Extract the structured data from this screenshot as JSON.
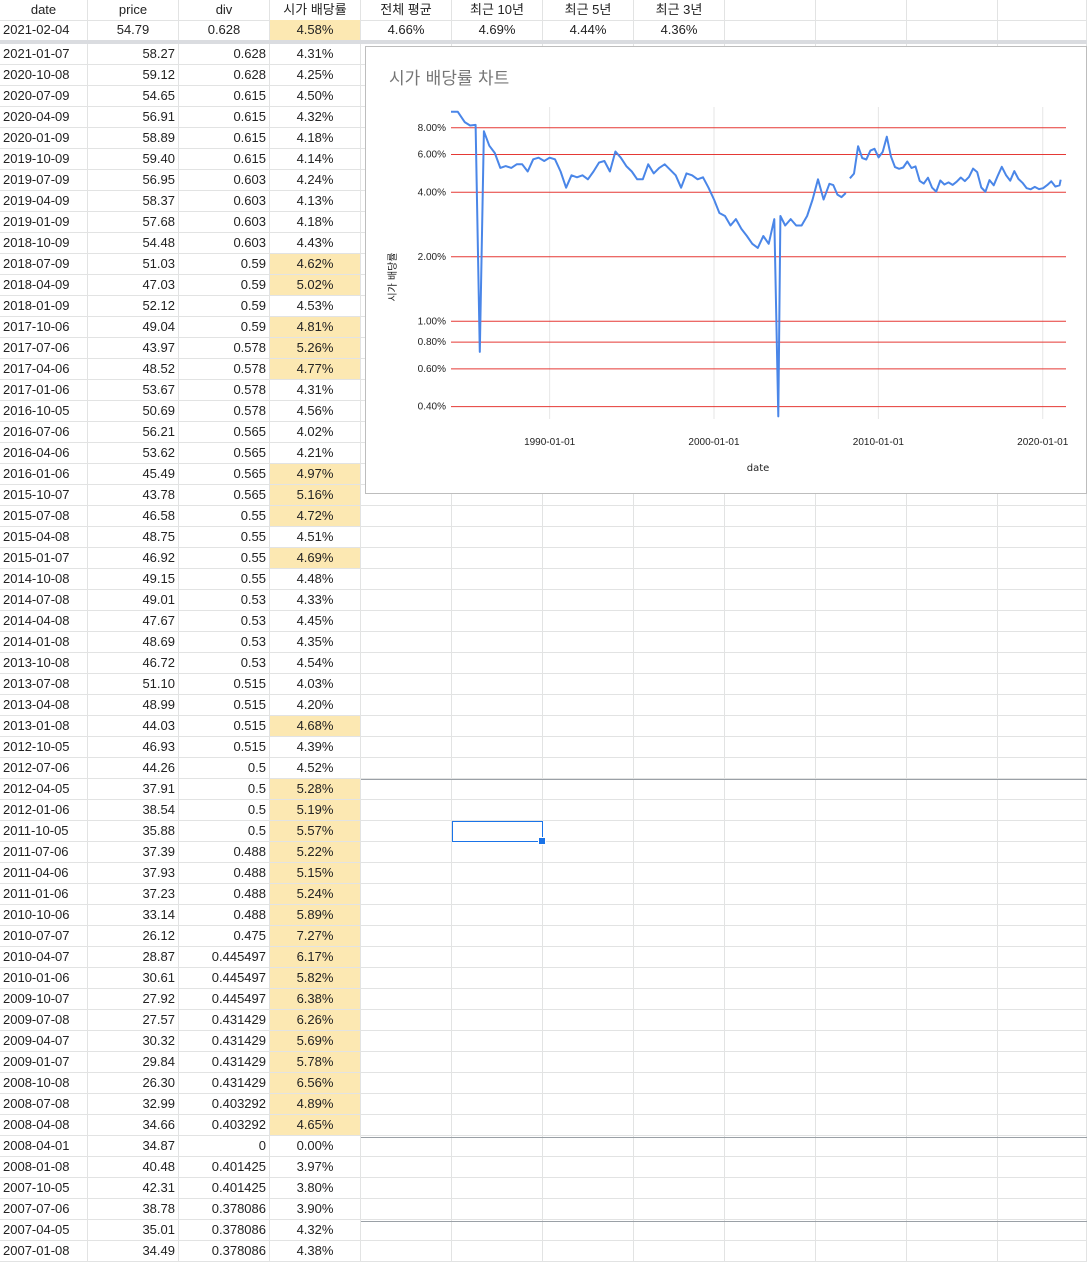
{
  "sheet": {
    "headers": [
      "date",
      "price",
      "div",
      "시가 배당률",
      "전체 평균",
      "최근 10년",
      "최근 5년",
      "최근 3년"
    ],
    "summary": [
      "2021-02-04",
      "54.79",
      "0.628",
      "4.58%",
      "4.66%",
      "4.69%",
      "4.44%",
      "4.36%"
    ],
    "rows": [
      [
        "2021-01-07",
        "58.27",
        "0.628",
        "4.31%"
      ],
      [
        "2020-10-08",
        "59.12",
        "0.628",
        "4.25%"
      ],
      [
        "2020-07-09",
        "54.65",
        "0.615",
        "4.50%"
      ],
      [
        "2020-04-09",
        "56.91",
        "0.615",
        "4.32%"
      ],
      [
        "2020-01-09",
        "58.89",
        "0.615",
        "4.18%"
      ],
      [
        "2019-10-09",
        "59.40",
        "0.615",
        "4.14%"
      ],
      [
        "2019-07-09",
        "56.95",
        "0.603",
        "4.24%"
      ],
      [
        "2019-04-09",
        "58.37",
        "0.603",
        "4.13%"
      ],
      [
        "2019-01-09",
        "57.68",
        "0.603",
        "4.18%"
      ],
      [
        "2018-10-09",
        "54.48",
        "0.603",
        "4.43%"
      ],
      [
        "2018-07-09",
        "51.03",
        "0.59",
        "4.62%"
      ],
      [
        "2018-04-09",
        "47.03",
        "0.59",
        "5.02%"
      ],
      [
        "2018-01-09",
        "52.12",
        "0.59",
        "4.53%"
      ],
      [
        "2017-10-06",
        "49.04",
        "0.59",
        "4.81%"
      ],
      [
        "2017-07-06",
        "43.97",
        "0.578",
        "5.26%"
      ],
      [
        "2017-04-06",
        "48.52",
        "0.578",
        "4.77%"
      ],
      [
        "2017-01-06",
        "53.67",
        "0.578",
        "4.31%"
      ],
      [
        "2016-10-05",
        "50.69",
        "0.578",
        "4.56%"
      ],
      [
        "2016-07-06",
        "56.21",
        "0.565",
        "4.02%"
      ],
      [
        "2016-04-06",
        "53.62",
        "0.565",
        "4.21%"
      ],
      [
        "2016-01-06",
        "45.49",
        "0.565",
        "4.97%"
      ],
      [
        "2015-10-07",
        "43.78",
        "0.565",
        "5.16%"
      ],
      [
        "2015-07-08",
        "46.58",
        "0.55",
        "4.72%"
      ],
      [
        "2015-04-08",
        "48.75",
        "0.55",
        "4.51%"
      ],
      [
        "2015-01-07",
        "46.92",
        "0.55",
        "4.69%"
      ],
      [
        "2014-10-08",
        "49.15",
        "0.55",
        "4.48%"
      ],
      [
        "2014-07-08",
        "49.01",
        "0.53",
        "4.33%"
      ],
      [
        "2014-04-08",
        "47.67",
        "0.53",
        "4.45%"
      ],
      [
        "2014-01-08",
        "48.69",
        "0.53",
        "4.35%"
      ],
      [
        "2013-10-08",
        "46.72",
        "0.53",
        "4.54%"
      ],
      [
        "2013-07-08",
        "51.10",
        "0.515",
        "4.03%"
      ],
      [
        "2013-04-08",
        "48.99",
        "0.515",
        "4.20%"
      ],
      [
        "2013-01-08",
        "44.03",
        "0.515",
        "4.68%"
      ],
      [
        "2012-10-05",
        "46.93",
        "0.515",
        "4.39%"
      ],
      [
        "2012-07-06",
        "44.26",
        "0.5",
        "4.52%"
      ],
      [
        "2012-04-05",
        "37.91",
        "0.5",
        "5.28%"
      ],
      [
        "2012-01-06",
        "38.54",
        "0.5",
        "5.19%"
      ],
      [
        "2011-10-05",
        "35.88",
        "0.5",
        "5.57%"
      ],
      [
        "2011-07-06",
        "37.39",
        "0.488",
        "5.22%"
      ],
      [
        "2011-04-06",
        "37.93",
        "0.488",
        "5.15%"
      ],
      [
        "2011-01-06",
        "37.23",
        "0.488",
        "5.24%"
      ],
      [
        "2010-10-06",
        "33.14",
        "0.488",
        "5.89%"
      ],
      [
        "2010-07-07",
        "26.12",
        "0.475",
        "7.27%"
      ],
      [
        "2010-04-07",
        "28.87",
        "0.445497",
        "6.17%"
      ],
      [
        "2010-01-06",
        "30.61",
        "0.445497",
        "5.82%"
      ],
      [
        "2009-10-07",
        "27.92",
        "0.445497",
        "6.38%"
      ],
      [
        "2009-07-08",
        "27.57",
        "0.431429",
        "6.26%"
      ],
      [
        "2009-04-07",
        "30.32",
        "0.431429",
        "5.69%"
      ],
      [
        "2009-01-07",
        "29.84",
        "0.431429",
        "5.78%"
      ],
      [
        "2008-10-08",
        "26.30",
        "0.431429",
        "6.56%"
      ],
      [
        "2008-07-08",
        "32.99",
        "0.403292",
        "4.89%"
      ],
      [
        "2008-04-08",
        "34.66",
        "0.403292",
        "4.65%"
      ],
      [
        "2008-04-01",
        "34.87",
        "0",
        "0.00%"
      ],
      [
        "2008-01-08",
        "40.48",
        "0.401425",
        "3.97%"
      ],
      [
        "2007-10-05",
        "42.31",
        "0.401425",
        "3.80%"
      ],
      [
        "2007-07-06",
        "38.78",
        "0.378086",
        "3.90%"
      ],
      [
        "2007-04-05",
        "35.01",
        "0.378086",
        "4.32%"
      ],
      [
        "2007-01-08",
        "34.49",
        "0.378086",
        "4.38%"
      ]
    ],
    "highlight_color": "#fce8b2",
    "highlight_threshold_pct": 4.58
  },
  "chart_data": {
    "type": "line",
    "title": "시가 배당률 차트",
    "xlabel": "date",
    "ylabel": "시가 배당률",
    "y_scale": "log",
    "ylim": [
      0.0035,
      0.1
    ],
    "xlim": [
      "1984-01-01",
      "2021-06-01"
    ],
    "x_ticks": [
      "1990-01-01",
      "2000-01-01",
      "2010-01-01",
      "2020-01-01"
    ],
    "y_ticks": [
      "0.40%",
      "0.60%",
      "0.80%",
      "1.00%",
      "2.00%",
      "4.00%",
      "6.00%",
      "8.00%"
    ],
    "y_tick_values": [
      0.004,
      0.006,
      0.008,
      0.01,
      0.02,
      0.04,
      0.06,
      0.08
    ],
    "grid_color": "#e53935",
    "line_color": "#4a86e8",
    "series": [
      {
        "values": [
          [
            "1984-01-01",
            0.095
          ],
          [
            "1984-06-01",
            0.095
          ],
          [
            "1984-11-01",
            0.085
          ],
          [
            "1985-03-01",
            0.082
          ],
          [
            "1985-07-01",
            0.0825
          ],
          [
            "1985-10-01",
            0.0072
          ],
          [
            "1986-01-01",
            0.077
          ],
          [
            "1986-05-01",
            0.066
          ],
          [
            "1986-09-01",
            0.061
          ],
          [
            "1987-01-01",
            0.052
          ],
          [
            "1987-05-01",
            0.053
          ],
          [
            "1987-09-01",
            0.052
          ],
          [
            "1988-01-01",
            0.054
          ],
          [
            "1988-05-01",
            0.054
          ],
          [
            "1988-09-01",
            0.05
          ],
          [
            "1989-01-01",
            0.057
          ],
          [
            "1989-05-01",
            0.058
          ],
          [
            "1989-09-01",
            0.056
          ],
          [
            "1990-01-01",
            0.058
          ],
          [
            "1990-05-01",
            0.057
          ],
          [
            "1990-09-01",
            0.05
          ],
          [
            "1991-01-01",
            0.042
          ],
          [
            "1991-05-01",
            0.048
          ],
          [
            "1991-09-01",
            0.047
          ],
          [
            "1992-01-01",
            0.048
          ],
          [
            "1992-05-01",
            0.046
          ],
          [
            "1992-09-01",
            0.05
          ],
          [
            "1993-01-01",
            0.055
          ],
          [
            "1993-05-01",
            0.056
          ],
          [
            "1993-09-01",
            0.05
          ],
          [
            "1994-01-01",
            0.062
          ],
          [
            "1994-05-01",
            0.058
          ],
          [
            "1994-09-01",
            0.053
          ],
          [
            "1995-01-01",
            0.05
          ],
          [
            "1995-05-01",
            0.046
          ],
          [
            "1995-09-01",
            0.046
          ],
          [
            "1996-01-01",
            0.054
          ],
          [
            "1996-05-01",
            0.049
          ],
          [
            "1996-09-01",
            0.052
          ],
          [
            "1997-01-01",
            0.054
          ],
          [
            "1997-05-01",
            0.051
          ],
          [
            "1997-09-01",
            0.048
          ],
          [
            "1998-01-01",
            0.042
          ],
          [
            "1998-05-01",
            0.049
          ],
          [
            "1998-09-01",
            0.048
          ],
          [
            "1999-01-01",
            0.046
          ],
          [
            "1999-05-01",
            0.047
          ],
          [
            "1999-09-01",
            0.042
          ],
          [
            "2000-01-01",
            0.037
          ],
          [
            "2000-05-01",
            0.032
          ],
          [
            "2000-09-01",
            0.031
          ],
          [
            "2001-01-01",
            0.028
          ],
          [
            "2001-05-01",
            0.03
          ],
          [
            "2001-09-01",
            0.027
          ],
          [
            "2002-01-01",
            0.025
          ],
          [
            "2002-05-01",
            0.023
          ],
          [
            "2002-09-01",
            0.022
          ],
          [
            "2003-01-01",
            0.025
          ],
          [
            "2003-05-01",
            0.023
          ],
          [
            "2003-09-01",
            0.03
          ],
          [
            "2003-12-01",
            0.0036
          ],
          [
            "2004-01-15",
            0.031
          ],
          [
            "2004-05-01",
            0.028
          ],
          [
            "2004-09-01",
            0.03
          ],
          [
            "2005-01-01",
            0.028
          ],
          [
            "2005-05-01",
            0.028
          ],
          [
            "2005-09-01",
            0.031
          ],
          [
            "2006-01-01",
            0.037
          ],
          [
            "2006-05-01",
            0.046
          ],
          [
            "2006-09-01",
            0.037
          ],
          [
            "2007-01-08",
            0.0438
          ],
          [
            "2007-04-05",
            0.0432
          ],
          [
            "2007-07-06",
            0.039
          ],
          [
            "2007-10-05",
            0.038
          ],
          [
            "2008-01-08",
            0.0397
          ],
          [
            "2008-04-01",
            null
          ],
          [
            "2008-04-08",
            0.0465
          ],
          [
            "2008-07-08",
            0.0489
          ],
          [
            "2008-10-08",
            0.0656
          ],
          [
            "2009-01-07",
            0.0578
          ],
          [
            "2009-04-07",
            0.0569
          ],
          [
            "2009-07-08",
            0.0626
          ],
          [
            "2009-10-07",
            0.0638
          ],
          [
            "2010-01-06",
            0.0582
          ],
          [
            "2010-04-07",
            0.0617
          ],
          [
            "2010-07-07",
            0.0727
          ],
          [
            "2010-10-06",
            0.0589
          ],
          [
            "2011-01-06",
            0.0524
          ],
          [
            "2011-04-06",
            0.0515
          ],
          [
            "2011-07-06",
            0.0522
          ],
          [
            "2011-10-05",
            0.0557
          ],
          [
            "2012-01-06",
            0.0519
          ],
          [
            "2012-04-05",
            0.0528
          ],
          [
            "2012-07-06",
            0.0452
          ],
          [
            "2012-10-05",
            0.0439
          ],
          [
            "2013-01-08",
            0.0468
          ],
          [
            "2013-04-08",
            0.042
          ],
          [
            "2013-07-08",
            0.0403
          ],
          [
            "2013-10-08",
            0.0454
          ],
          [
            "2014-01-08",
            0.0435
          ],
          [
            "2014-04-08",
            0.0445
          ],
          [
            "2014-07-08",
            0.0433
          ],
          [
            "2014-10-08",
            0.0448
          ],
          [
            "2015-01-07",
            0.0469
          ],
          [
            "2015-04-08",
            0.0451
          ],
          [
            "2015-07-08",
            0.0472
          ],
          [
            "2015-10-07",
            0.0516
          ],
          [
            "2016-01-06",
            0.0497
          ],
          [
            "2016-04-06",
            0.0421
          ],
          [
            "2016-07-06",
            0.0402
          ],
          [
            "2016-10-05",
            0.0456
          ],
          [
            "2017-01-06",
            0.0431
          ],
          [
            "2017-04-06",
            0.0477
          ],
          [
            "2017-07-06",
            0.0526
          ],
          [
            "2017-10-06",
            0.0481
          ],
          [
            "2018-01-09",
            0.0453
          ],
          [
            "2018-04-09",
            0.0502
          ],
          [
            "2018-07-09",
            0.0462
          ],
          [
            "2018-10-09",
            0.0443
          ],
          [
            "2019-01-09",
            0.0418
          ],
          [
            "2019-04-09",
            0.0413
          ],
          [
            "2019-07-09",
            0.0424
          ],
          [
            "2019-10-09",
            0.0414
          ],
          [
            "2020-01-09",
            0.0418
          ],
          [
            "2020-04-09",
            0.0432
          ],
          [
            "2020-07-09",
            0.045
          ],
          [
            "2020-10-08",
            0.0425
          ],
          [
            "2021-01-07",
            0.0431
          ],
          [
            "2021-02-04",
            0.0458
          ]
        ]
      }
    ]
  }
}
